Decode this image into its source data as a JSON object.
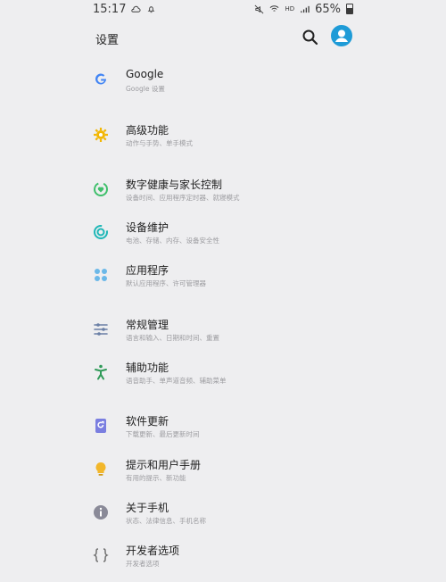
{
  "status_bar": {
    "time": "15:17",
    "network": "HD",
    "battery": "65%"
  },
  "app_bar": {
    "title": "设置"
  },
  "settings": [
    {
      "title": "Google",
      "subtitle": "Google 设置",
      "icon": "google-icon",
      "color": "#4285f4"
    },
    {
      "title": "高级功能",
      "subtitle": "动作与手势、单手模式",
      "icon": "star-gear-icon",
      "color": "#f2b705"
    },
    {
      "title": "数字健康与家长控制",
      "subtitle": "设备时间、应用程序定时器、就寝模式",
      "icon": "wellbeing-icon",
      "color": "#3fbf6b"
    },
    {
      "title": "设备维护",
      "subtitle": "电池、存储、内存、设备安全性",
      "icon": "maintenance-icon",
      "color": "#1fb7b7"
    },
    {
      "title": "应用程序",
      "subtitle": "默认应用程序、许可管理器",
      "icon": "apps-icon",
      "color": "#6bb8e8"
    },
    {
      "title": "常规管理",
      "subtitle": "语言和输入、日期和时间、重置",
      "icon": "sliders-icon",
      "color": "#6a7fa6"
    },
    {
      "title": "辅助功能",
      "subtitle": "语音助手、单声道音频、辅助菜单",
      "icon": "accessibility-icon",
      "color": "#2f9a58"
    },
    {
      "title": "软件更新",
      "subtitle": "下载更新、最后更新时间",
      "icon": "software-update-icon",
      "color": "#7a7ee0"
    },
    {
      "title": "提示和用户手册",
      "subtitle": "有用的提示、新功能",
      "icon": "lightbulb-icon",
      "color": "#f2b72b"
    },
    {
      "title": "关于手机",
      "subtitle": "状态、法律信息、手机名称",
      "icon": "info-icon",
      "color": "#8a8a98"
    },
    {
      "title": "开发者选项",
      "subtitle": "开发者选项",
      "icon": "braces-icon",
      "color": "#6f6f6f"
    }
  ]
}
